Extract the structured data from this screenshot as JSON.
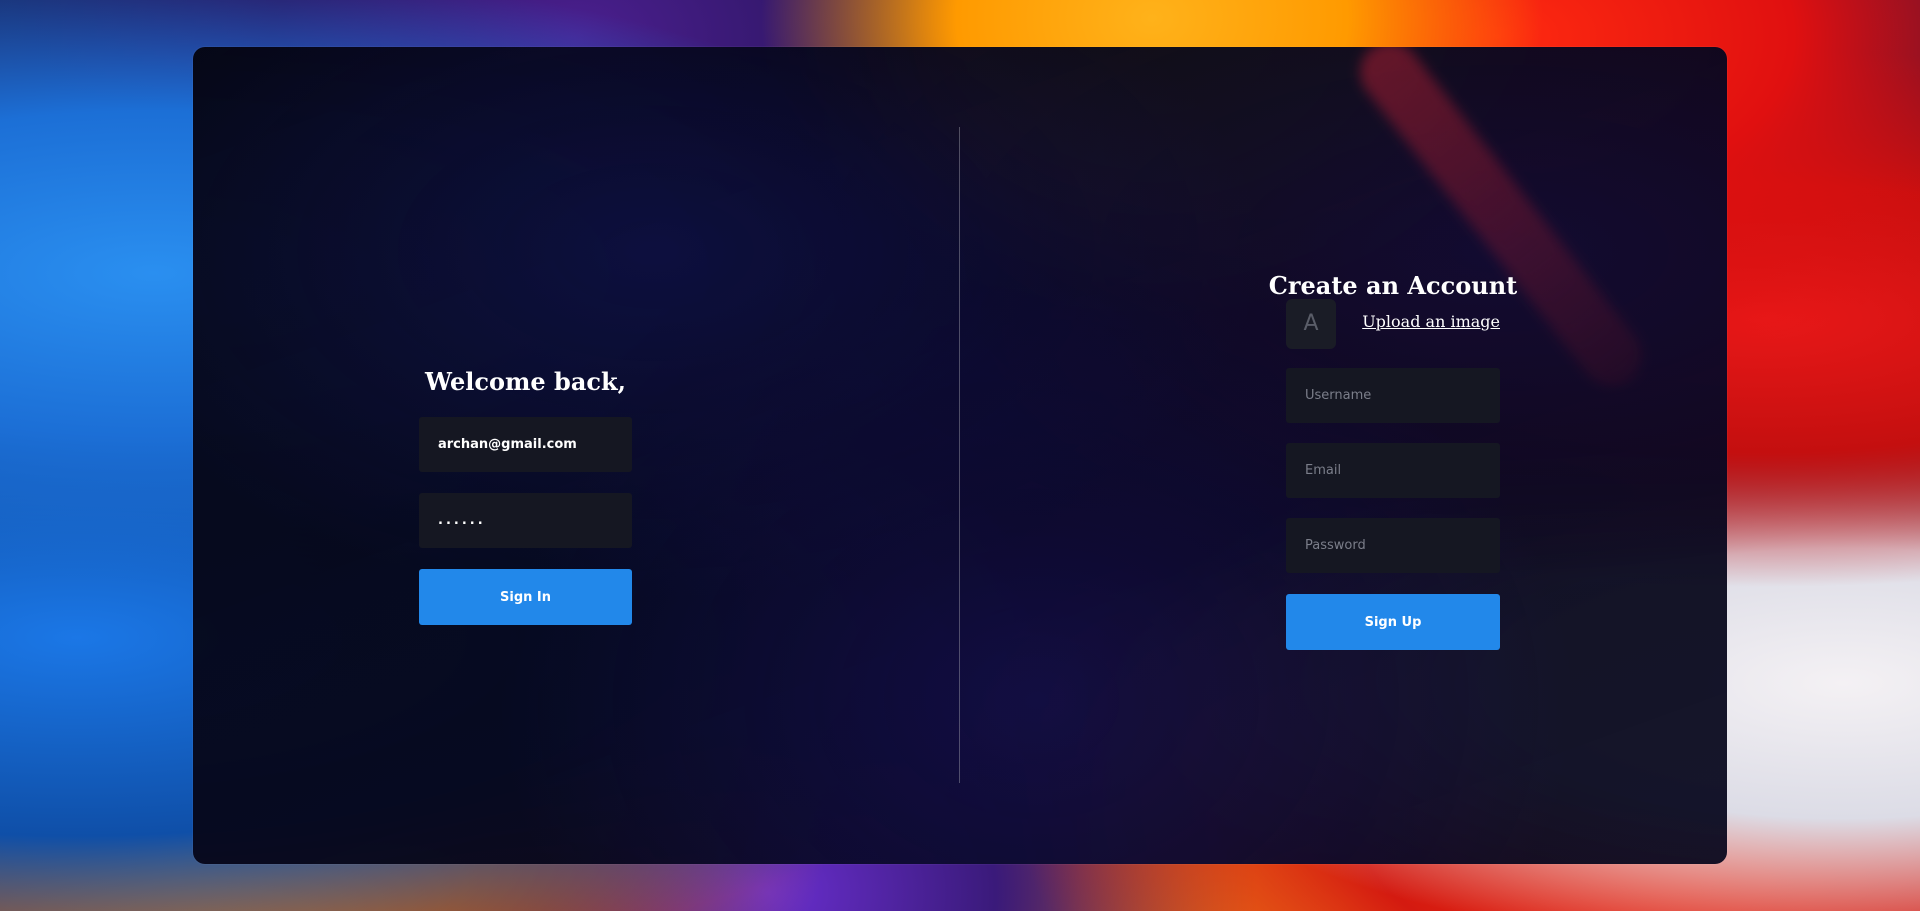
{
  "signin": {
    "title": "Welcome back,",
    "email_value": "archan@gmail.com",
    "password_value": "......",
    "button_label": "Sign In"
  },
  "signup": {
    "title": "Create an Account",
    "avatar_letter": "A",
    "upload_label": "Upload an image",
    "username_placeholder": "Username",
    "email_placeholder": "Email",
    "password_placeholder": "Password",
    "button_label": "Sign Up"
  },
  "colors": {
    "accent": "#2288ea",
    "field_bg": "#151722",
    "card_bg": "#06061a"
  }
}
